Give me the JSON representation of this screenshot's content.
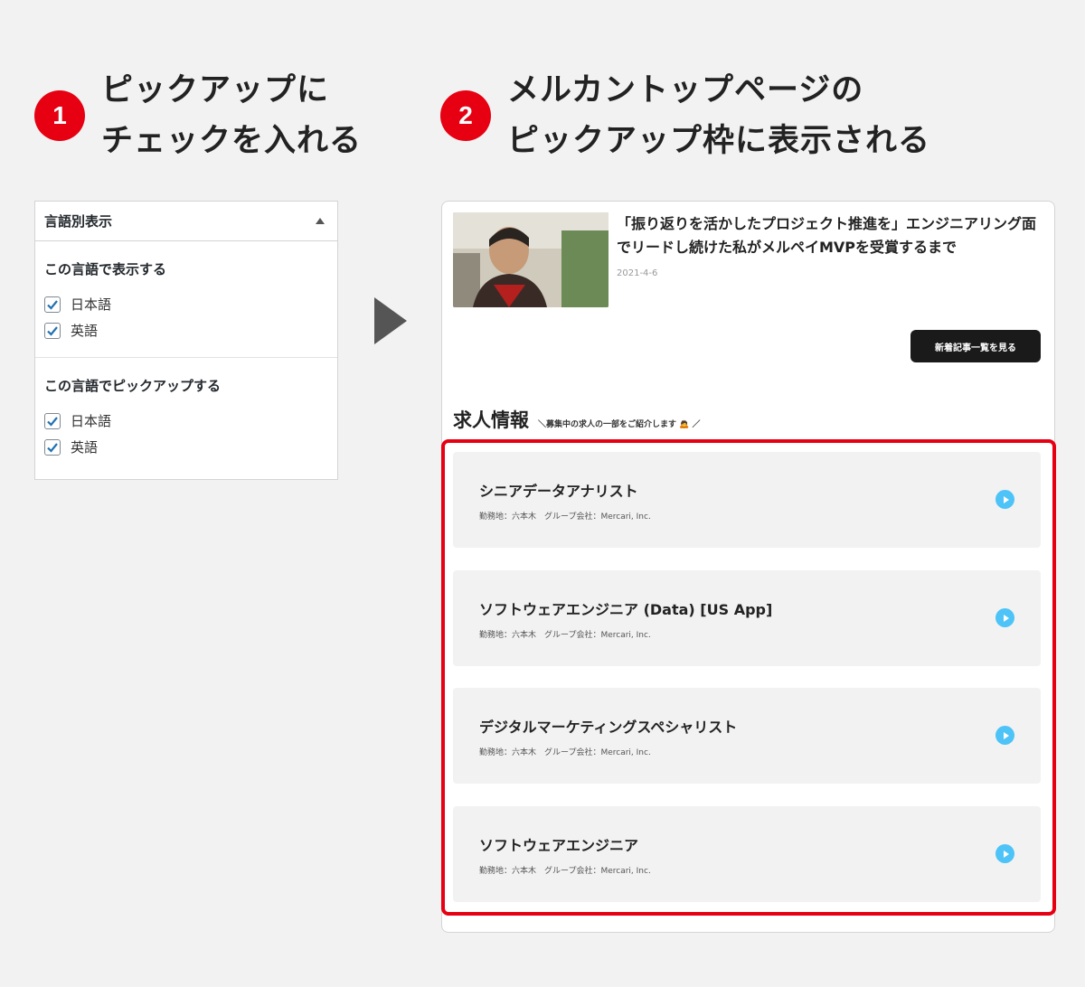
{
  "steps": [
    {
      "number": "1",
      "line1": "ピックアップに",
      "line2": "チェックを入れる"
    },
    {
      "number": "2",
      "line1": "メルカントップページの",
      "line2": "ピックアップ枠に表示される"
    }
  ],
  "settings_panel": {
    "title": "言語別表示",
    "display_section": {
      "title": "この言語で表示する",
      "options": [
        {
          "label": "日本語",
          "checked": true
        },
        {
          "label": "英語",
          "checked": true
        }
      ]
    },
    "pickup_section": {
      "title": "この言語でピックアップする",
      "options": [
        {
          "label": "日本語",
          "checked": true
        },
        {
          "label": "英語",
          "checked": true
        }
      ]
    }
  },
  "site_preview": {
    "article": {
      "title": "「振り返りを活かしたプロジェクト推進を」エンジニアリング面でリードし続けた私がメルペイMVPを受賞するまで",
      "date": "2021-4-6"
    },
    "more_button": "新着記事一覧を見る",
    "jobs_title": "求人情報",
    "jobs_subtitle": "＼募集中の求人の一部をご紹介します 🙇 ／",
    "jobs": [
      {
        "title": "シニアデータアナリスト",
        "meta": "勤務地：六本木　グループ会社：Mercari, Inc."
      },
      {
        "title": "ソフトウェアエンジニア (Data) [US App]",
        "meta": "勤務地：六本木　グループ会社：Mercari, Inc."
      },
      {
        "title": "デジタルマーケティングスペシャリスト",
        "meta": "勤務地：六本木　グループ会社：Mercari, Inc."
      },
      {
        "title": "ソフトウェアエンジニア",
        "meta": "勤務地：六本木　グループ会社：Mercari, Inc."
      }
    ]
  },
  "colors": {
    "accent": "#e60012",
    "play": "#4dc3f7",
    "checkbox": "#2271b1"
  }
}
